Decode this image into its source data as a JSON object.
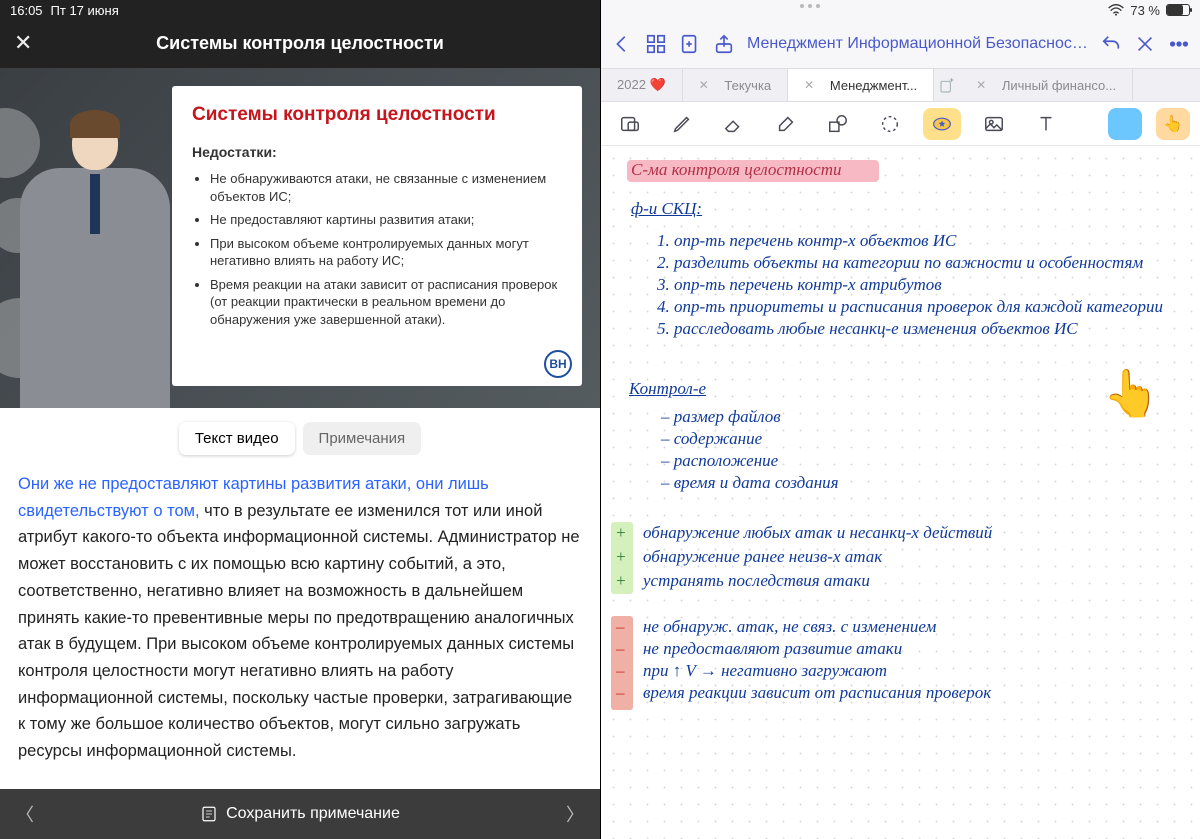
{
  "status": {
    "time": "16:05",
    "date": "Пт 17 июня",
    "battery": "73 %"
  },
  "left": {
    "title": "Системы контроля целостности",
    "slide": {
      "heading": "Системы контроля целостности",
      "sub": "Недостатки:",
      "bullets": [
        "Не обнаруживаются атаки, не связанные с изменением объектов ИС;",
        "Не предоставляют картины развития атаки;",
        "При высоком объеме контролируемых данных могут негативно влиять на работу ИС;",
        "Время реакции на атаки зависит от расписания проверок (от реакции практически в реальном времени до обнаружения уже завершенной атаки)."
      ],
      "logo": "ВН"
    },
    "tabs": {
      "a": "Текст видео",
      "b": "Примечания"
    },
    "transcript_hl": "Они же не предоставляют картины развития атаки, они лишь свидетельствуют о том, ",
    "transcript": "что в результате ее изменился тот или иной атрибут какого-то объекта информационной системы. Администратор не может восстановить с их помощью всю картину событий, а это, соответственно, негативно влияет на возможность в дальнейшем принять какие-то превентивные меры по предотвращению аналогичных атак в будущем. При высоком объеме контролируемых данных системы контроля целостности могут негативно влиять на работу информационной системы, поскольку частые проверки, затрагивающие к тому же большое количество объектов, могут сильно загружать ресурсы информационной системы.",
    "save": "Сохранить примечание"
  },
  "right": {
    "doc_title": "Менеджмент Информационной Безопасности",
    "tabs": [
      {
        "label": "2022 ❤️"
      },
      {
        "label": "Текучка"
      },
      {
        "label": "Менеджмент..."
      },
      {
        "label": "Личный финансо..."
      }
    ],
    "notes": {
      "title": "С-ма  контроля  целостности",
      "sub": "ф-и   СКЦ:",
      "fns": [
        "1. опр-ть  перечень  контр-х  объектов  ИС",
        "2. разделить  объекты  на  категории  по важности  и особенностям",
        "3. опр-ть  перечень  контр-х  атрибутов",
        "4. опр-ть  приоритеты  и  расписания  проверок  для  каждой  категории",
        "5. расследовать  любые  несанкц-е  изменения  объектов  ИС"
      ],
      "k_head": "Контрол-е",
      "k": [
        "– размер  файлов",
        "– содержание",
        "– расположение",
        "– время  и дата  создания"
      ],
      "plus": [
        "обнаружение  любых  атак  и  несанкц-х  действий",
        "обнаружение  ранее  неизв-х  атак",
        "устранять  последствия  атаки"
      ],
      "minus": [
        "не  обнаруж.  атак,  не  связ.  с  изменением",
        "не  предоставляют  развитие  атаки",
        "при  ↑  V  →  негативно  загружают",
        "время  реакции  зависит  от  расписания  проверок"
      ],
      "plus_sym": "+",
      "minus_sym": "–"
    }
  }
}
